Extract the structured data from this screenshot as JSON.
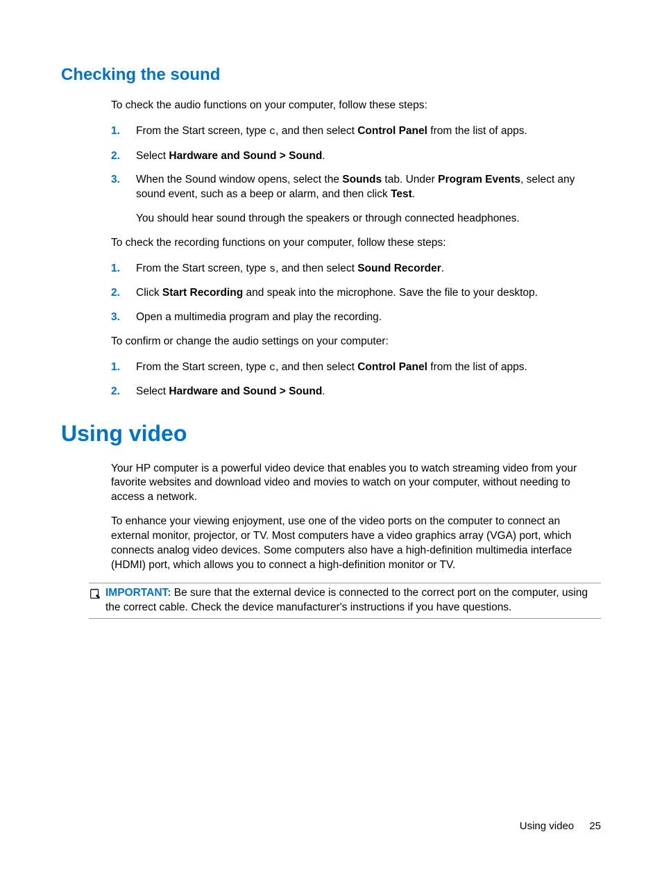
{
  "section1": {
    "heading": "Checking the sound",
    "intro1": "To check the audio functions on your computer, follow these steps:",
    "list1": [
      {
        "num": "1.",
        "pre": "From the Start screen, type ",
        "kbd": "c",
        "mid1": ", and then select ",
        "bold1": "Control Panel",
        "post": " from the list of apps."
      },
      {
        "num": "2.",
        "pre": "Select ",
        "bold1": "Hardware and Sound > Sound",
        "post": "."
      },
      {
        "num": "3.",
        "p1_pre": "When the Sound window opens, select the ",
        "p1_b1": "Sounds",
        "p1_mid1": " tab. Under ",
        "p1_b2": "Program Events",
        "p1_mid2": ", select any sound event, such as a beep or alarm, and then click ",
        "p1_b3": "Test",
        "p1_post": ".",
        "p2": "You should hear sound through the speakers or through connected headphones."
      }
    ],
    "intro2": "To check the recording functions on your computer, follow these steps:",
    "list2": [
      {
        "num": "1.",
        "pre": "From the Start screen, type ",
        "kbd": "s",
        "mid1": ", and then select ",
        "bold1": "Sound Recorder",
        "post": "."
      },
      {
        "num": "2.",
        "pre": "Click ",
        "bold1": "Start Recording",
        "post": " and speak into the microphone. Save the file to your desktop."
      },
      {
        "num": "3.",
        "text": "Open a multimedia program and play the recording."
      }
    ],
    "intro3": "To confirm or change the audio settings on your computer:",
    "list3": [
      {
        "num": "1.",
        "pre": "From the Start screen, type ",
        "kbd": "c",
        "mid1": ", and then select ",
        "bold1": "Control Panel",
        "post": " from the list of apps."
      },
      {
        "num": "2.",
        "pre": "Select ",
        "bold1": "Hardware and Sound > Sound",
        "post": "."
      }
    ]
  },
  "section2": {
    "heading": "Using video",
    "para1": "Your HP computer is a powerful video device that enables you to watch streaming video from your favorite websites and download video and movies to watch on your computer, without needing to access a network.",
    "para2": "To enhance your viewing enjoyment, use one of the video ports on the computer to connect an external monitor, projector, or TV. Most computers have a video graphics array (VGA) port, which connects analog video devices. Some computers also have a high-definition multimedia interface (HDMI) port, which allows you to connect a high-definition monitor or TV.",
    "important_label": "IMPORTANT:",
    "important_text": "   Be sure that the external device is connected to the correct port on the computer, using the correct cable. Check the device manufacturer's instructions if you have questions."
  },
  "footer": {
    "label": "Using video",
    "page": "25"
  }
}
